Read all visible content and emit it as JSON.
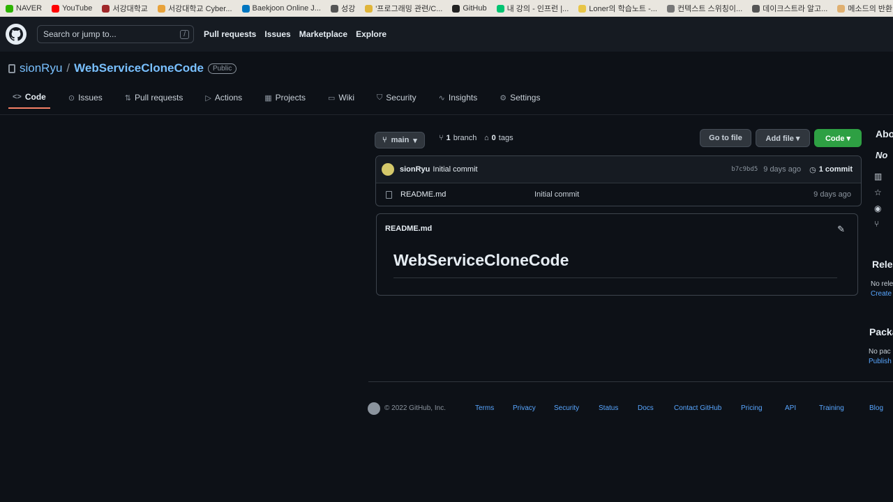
{
  "bookmarks": [
    {
      "label": "NAVER",
      "color": "#2db400"
    },
    {
      "label": "YouTube",
      "color": "#ff0000"
    },
    {
      "label": "서강대학교",
      "color": "#a0282a"
    },
    {
      "label": "서강대학교 Cyber...",
      "color": "#e8a23a"
    },
    {
      "label": "Baekjoon Online J...",
      "color": "#0076c0"
    },
    {
      "label": "성강",
      "color": "#555555"
    },
    {
      "label": "'프로그래밍 관련/C...",
      "color": "#e0b53a"
    },
    {
      "label": "GitHub",
      "color": "#222222"
    },
    {
      "label": "내 강의 - 인프런 |...",
      "color": "#00c471"
    },
    {
      "label": "Loner의 학습노트 -...",
      "color": "#e8c547"
    },
    {
      "label": "컨텍스트 스위칭이...",
      "color": "#777777"
    },
    {
      "label": "데이크스트라 알고...",
      "color": "#555555"
    },
    {
      "label": "메소드의 반환 값에...",
      "color": "#e0b070"
    }
  ],
  "header": {
    "search_placeholder": "Search or jump to...",
    "search_key": "/",
    "nav": [
      "Pull requests",
      "Issues",
      "Marketplace",
      "Explore"
    ]
  },
  "repo": {
    "owner": "sionRyu",
    "separator": "/",
    "name": "WebServiceCloneCode",
    "visibility": "Public"
  },
  "tabs": [
    {
      "label": "Code",
      "icon": "<>"
    },
    {
      "label": "Issues",
      "icon": "⊙"
    },
    {
      "label": "Pull requests",
      "icon": "⇅"
    },
    {
      "label": "Actions",
      "icon": "▷"
    },
    {
      "label": "Projects",
      "icon": "▦"
    },
    {
      "label": "Wiki",
      "icon": "▭"
    },
    {
      "label": "Security",
      "icon": "⛉"
    },
    {
      "label": "Insights",
      "icon": "∿"
    },
    {
      "label": "Settings",
      "icon": "⚙"
    }
  ],
  "toolbar": {
    "branch": "main",
    "branch_count": "1",
    "branch_label": "branch",
    "tag_count": "0",
    "tag_label": "tags",
    "goto_file": "Go to file",
    "add_file": "Add file ▾",
    "code": "Code ▾"
  },
  "commit": {
    "author": "sionRyu",
    "message": "Initial commit",
    "sha": "b7c9bd5",
    "time": "9 days ago",
    "count": "1 commit"
  },
  "files": [
    {
      "name": "README.md",
      "message": "Initial commit",
      "time": "9 days ago"
    }
  ],
  "readme": {
    "filename": "README.md",
    "heading": "WebServiceCloneCode"
  },
  "sidebar": {
    "about_heading": "Abo",
    "no_desc": "No",
    "releases_heading": "Rele",
    "no_releases": "No rele",
    "create_link": "Create",
    "packages_heading": "Packa",
    "no_packages": "No pac",
    "publish_link": "Publish"
  },
  "footer": {
    "copyright": "© 2022 GitHub, Inc.",
    "links": [
      "Terms",
      "Privacy",
      "Security",
      "Status",
      "Docs",
      "Contact GitHub",
      "Pricing",
      "API",
      "Training",
      "Blog"
    ]
  }
}
